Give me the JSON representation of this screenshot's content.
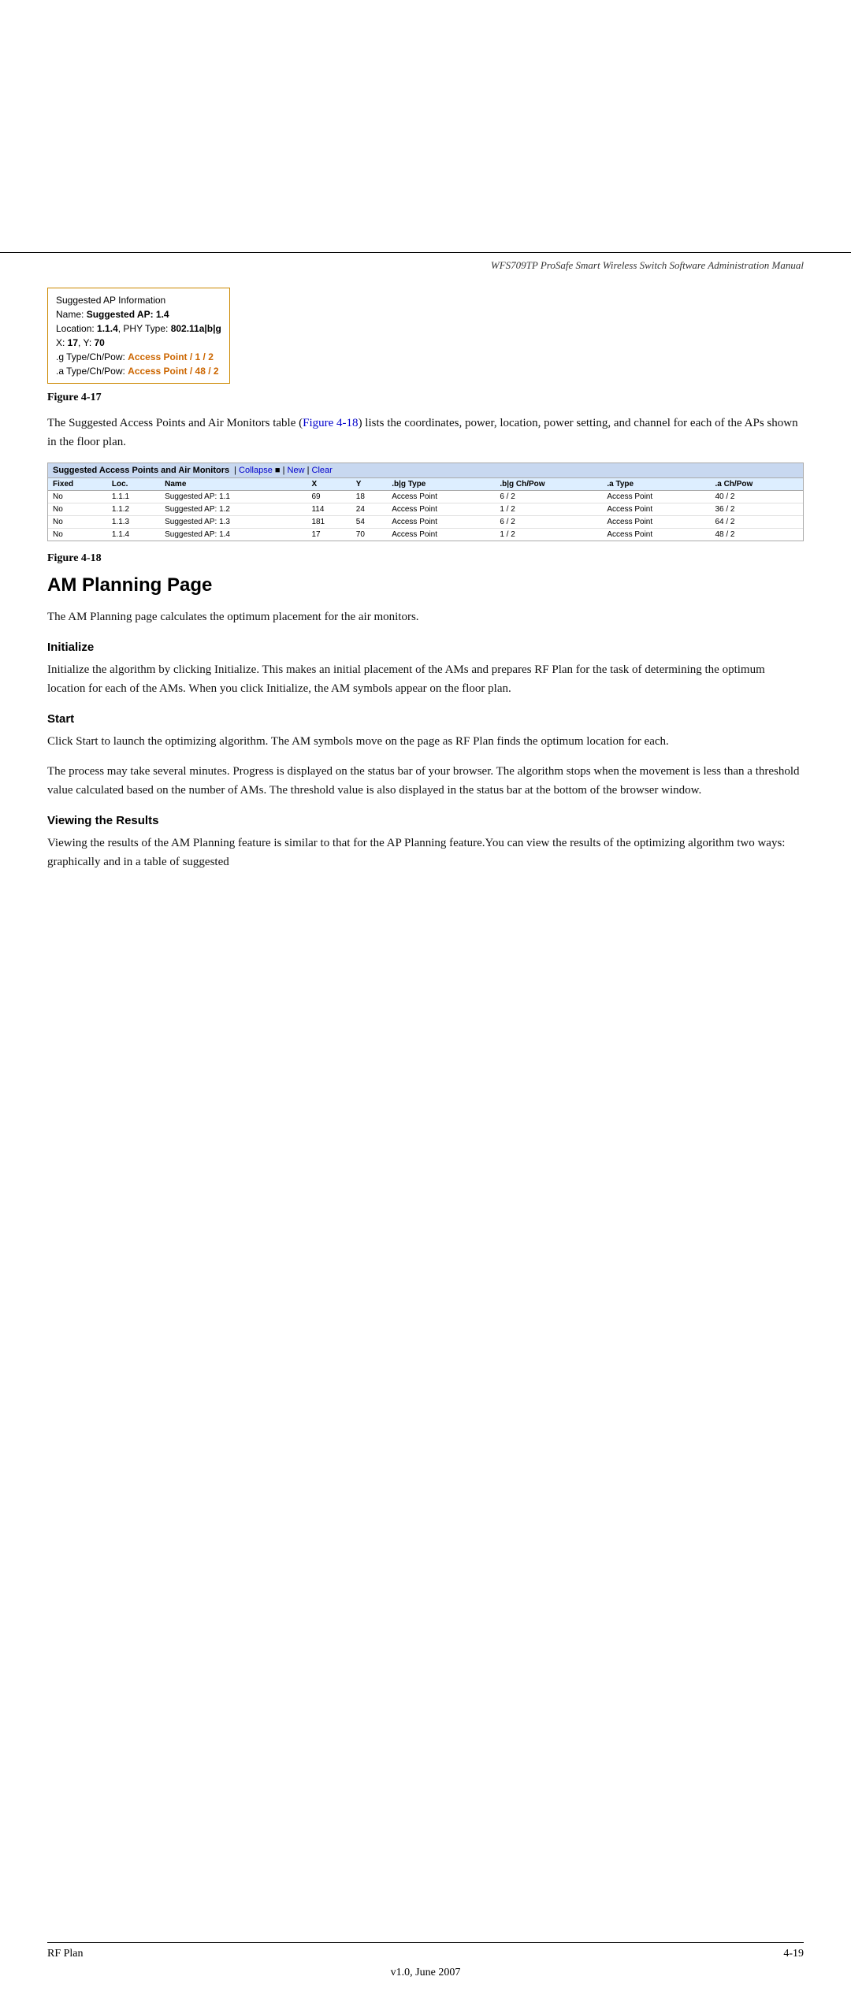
{
  "header": {
    "title": "WFS709TP ProSafe Smart Wireless Switch Software Administration Manual"
  },
  "figure17": {
    "label": "Figure 4-17",
    "tooltip": {
      "line1": "Suggested AP Information",
      "line2_prefix": "Name: ",
      "line2_bold": "Suggested AP: 1.4",
      "line3_prefix": "Location: ",
      "line3_bold1": "1.1.4",
      "line3_suffix": ", PHY Type: ",
      "line3_bold2": "802.11a|b|g",
      "line4_prefix": "X: ",
      "line4_bold": "17",
      "line4_suffix": ", Y: ",
      "line4_bold2": "70",
      "line5_prefix": ".g Type/Ch/Pow: ",
      "line5_bold": "Access Point",
      "line5_suffix": " / 1 / 2",
      "line6_prefix": ".a Type/Ch/Pow: ",
      "line6_bold": "Access Point",
      "line6_suffix": " / 48 / 2"
    }
  },
  "para1": {
    "text_before": "The Suggested Access Points and Air Monitors table (",
    "link_text": "Figure 4-18",
    "text_after": ") lists the coordinates, power, location, power setting, and channel for each of the APs shown in the floor plan."
  },
  "figure18_table": {
    "title": "Suggested Access Points and Air Monitors",
    "collapse_label": "Collapse",
    "new_label": "New",
    "clear_label": "Clear",
    "columns": [
      "Fixed",
      "Loc.",
      "Name",
      "X",
      "Y",
      ".b|g Type",
      ".b|g Ch/Pow",
      ".a Type",
      ".a Ch/Pow"
    ],
    "rows": [
      {
        "fixed": "No",
        "loc": "1.1.1",
        "name": "Suggested AP: 1.1",
        "x": "69",
        "y": "18",
        "bg_type": "Access Point",
        "bg_ch_pow": "6 / 2",
        "a_type": "Access Point",
        "a_ch_pow": "40 / 2"
      },
      {
        "fixed": "No",
        "loc": "1.1.2",
        "name": "Suggested AP: 1.2",
        "x": "114",
        "y": "24",
        "bg_type": "Access Point",
        "bg_ch_pow": "1 / 2",
        "a_type": "Access Point",
        "a_ch_pow": "36 / 2"
      },
      {
        "fixed": "No",
        "loc": "1.1.3",
        "name": "Suggested AP: 1.3",
        "x": "181",
        "y": "54",
        "bg_type": "Access Point",
        "bg_ch_pow": "6 / 2",
        "a_type": "Access Point",
        "a_ch_pow": "64 / 2"
      },
      {
        "fixed": "No",
        "loc": "1.1.4",
        "name": "Suggested AP: 1.4",
        "x": "17",
        "y": "70",
        "bg_type": "Access Point",
        "bg_ch_pow": "1 / 2",
        "a_type": "Access Point",
        "a_ch_pow": "48 / 2"
      }
    ]
  },
  "figure18_label": "Figure 4-18",
  "am_planning": {
    "page_title": "AM Planning Page",
    "intro": "The AM Planning page calculates the optimum placement for the air monitors.",
    "initialize_heading": "Initialize",
    "initialize_text": "Initialize the algorithm by clicking Initialize. This makes an initial placement of the AMs and prepares RF Plan for the task of determining the optimum location for each of the AMs. When you click Initialize, the AM symbols appear on the floor plan.",
    "start_heading": "Start",
    "start_text1": "Click Start to launch the optimizing algorithm. The AM symbols move on the page as RF Plan finds the optimum location for each.",
    "start_text2": "The process may take several minutes. Progress is displayed on the status bar of your browser. The algorithm stops when the movement is less than a threshold value calculated based on the number of AMs. The threshold value is also displayed in the status bar at the bottom of the browser window.",
    "viewing_heading": "Viewing the Results",
    "viewing_text": "Viewing the results of the AM Planning feature is similar to that for the AP Planning feature.You can view the results of the optimizing algorithm two ways: graphically and in a table of suggested"
  },
  "footer": {
    "left": "RF Plan",
    "right": "4-19",
    "version": "v1.0, June 2007"
  }
}
